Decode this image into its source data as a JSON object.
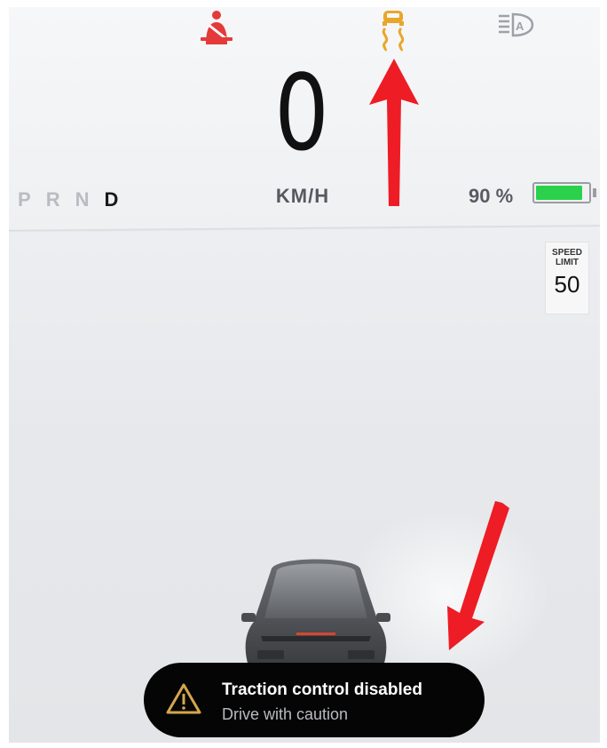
{
  "header": {
    "icons": {
      "seatbelt": "seatbelt-warning-icon",
      "traction": "traction-control-icon",
      "headlight": "auto-headlight-icon"
    }
  },
  "speedometer": {
    "speed": "0",
    "unit": "KM/H"
  },
  "gear_selector": {
    "gears": [
      "P",
      "R",
      "N",
      "D"
    ],
    "active": "D"
  },
  "battery": {
    "percent_text": "90 %",
    "level": 0.9,
    "color": "#2bd14a"
  },
  "speed_limit": {
    "label": "SPEED\nLIMIT",
    "value": "50"
  },
  "notification": {
    "title": "Traction control disabled",
    "subtitle": "Drive with caution",
    "icon": "warning-triangle-icon",
    "icon_color": "#d4a64a"
  },
  "colors": {
    "seatbelt_red": "#e43a3a",
    "traction_amber": "#e8a62a",
    "annotation_arrow": "#ee1c24"
  }
}
